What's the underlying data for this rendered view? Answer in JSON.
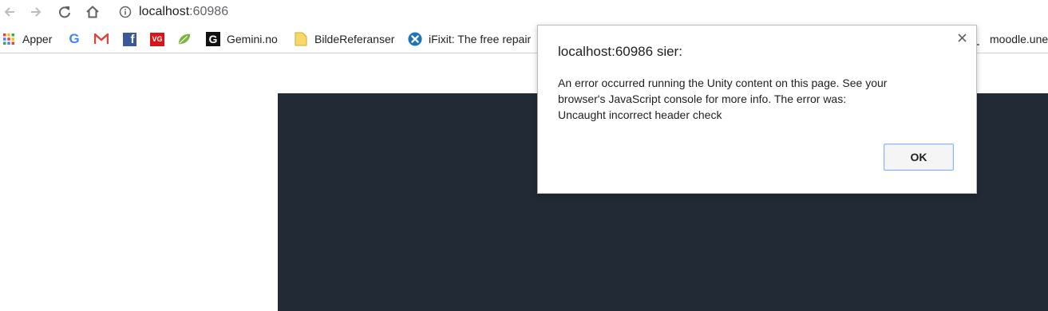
{
  "address_bar": {
    "host": "localhost",
    "port": ":60986"
  },
  "bookmarks": [
    {
      "label": "Apper",
      "icon": "apps-grid-icon"
    },
    {
      "label": "",
      "icon": "google-icon"
    },
    {
      "label": "",
      "icon": "gmail-icon"
    },
    {
      "label": "",
      "icon": "facebook-icon"
    },
    {
      "label": "",
      "icon": "vg-icon"
    },
    {
      "label": "",
      "icon": "leaf-icon"
    },
    {
      "label": "Gemini.no",
      "icon": "gemini-icon"
    },
    {
      "label": "BildeReferanser",
      "icon": "folder-icon"
    },
    {
      "label": "iFixit: The free repair",
      "icon": "ifixit-icon"
    },
    {
      "label": "moodle.une",
      "icon": "page-icon"
    }
  ],
  "dialog": {
    "title": "localhost:60986 sier:",
    "message_lines": [
      "An error occurred running the Unity content on this page. See your",
      "browser's JavaScript console for more info. The error was:",
      "Uncaught incorrect header check"
    ],
    "ok_label": "OK"
  },
  "colors": {
    "unity_canvas": "#222a35",
    "facebook_blue": "#3b5998",
    "vg_red": "#d7141a",
    "ifixit_blue": "#1f73b7",
    "folder_yellow": "#f9d86a"
  }
}
